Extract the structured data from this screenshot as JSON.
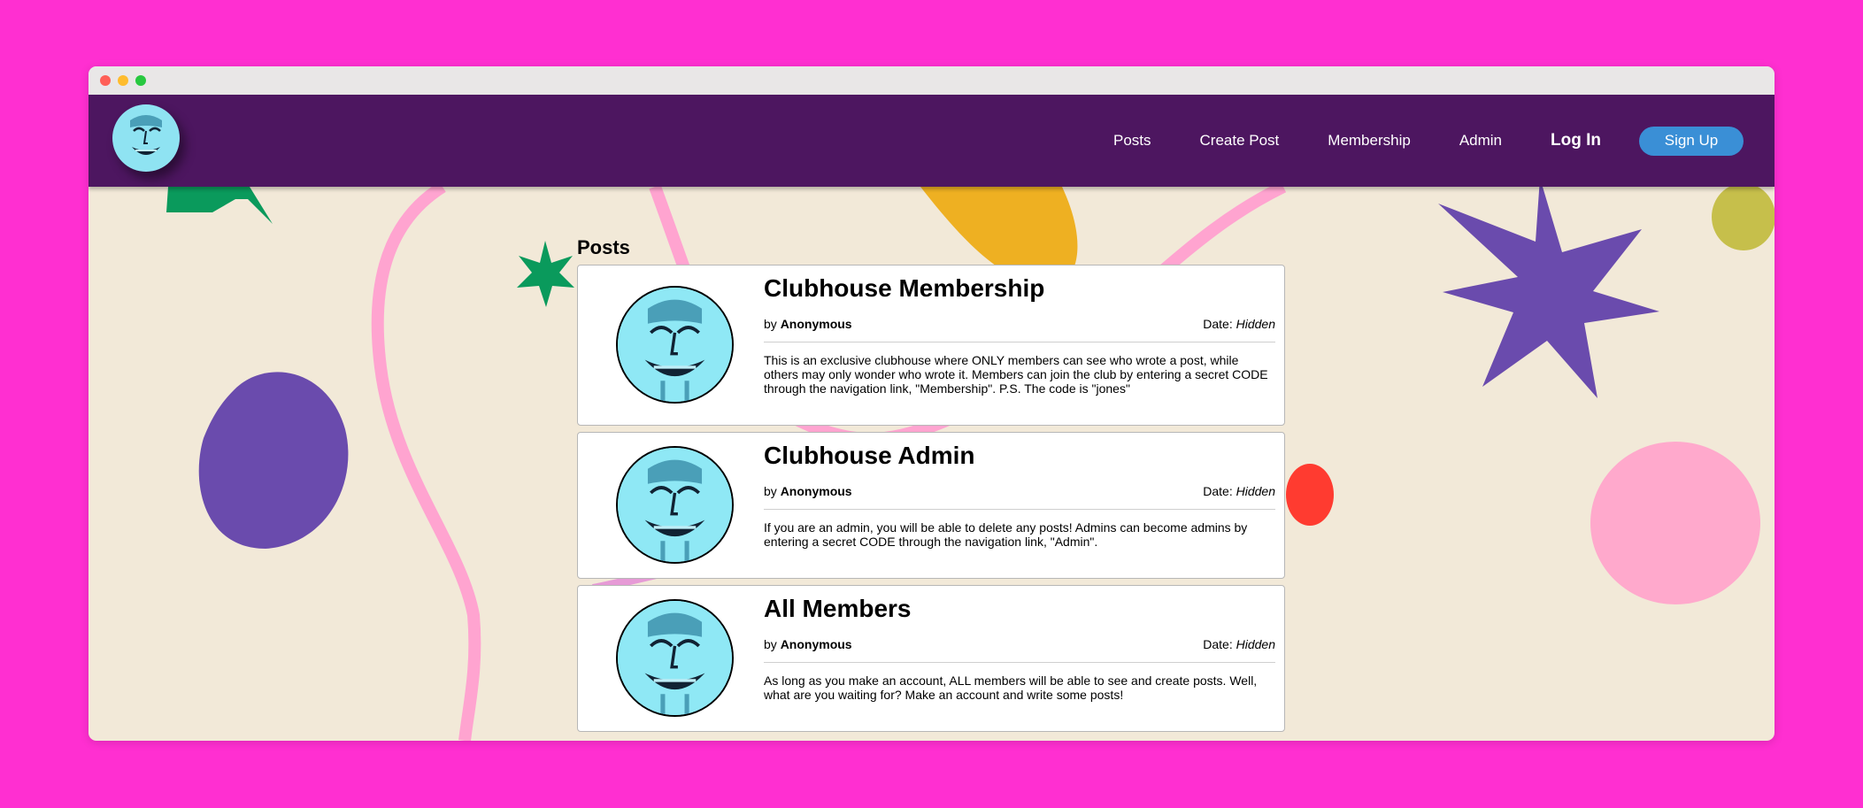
{
  "colors": {
    "background": "#ff2fd1",
    "navbar": "#4d1660",
    "page": "#f2e9d8",
    "signup": "#3a8fd6"
  },
  "logo_icon": "grinning-face-avatar-icon",
  "nav": {
    "links": [
      "Posts",
      "Create Post",
      "Membership",
      "Admin"
    ],
    "login": "Log In",
    "signup": "Sign Up"
  },
  "main": {
    "section_title": "Posts",
    "posts": [
      {
        "title": "Clubhouse Membership",
        "by_label": "by",
        "author": "Anonymous",
        "date_label": "Date:",
        "date": "Hidden",
        "text": "This is an exclusive clubhouse where ONLY members can see who wrote a post, while others may only wonder who wrote it. Members can join the club by entering a secret CODE through the navigation link, \"Membership\". P.S. The code is \"jones\""
      },
      {
        "title": "Clubhouse Admin",
        "by_label": "by",
        "author": "Anonymous",
        "date_label": "Date:",
        "date": "Hidden",
        "text": "If you are an admin, you will be able to delete any posts! Admins can become admins by entering a secret CODE through the navigation link, \"Admin\"."
      },
      {
        "title": "All Members",
        "by_label": "by",
        "author": "Anonymous",
        "date_label": "Date:",
        "date": "Hidden",
        "text": "As long as you make an account, ALL members will be able to see and create posts. Well, what are you waiting for? Make an account and write some posts!"
      }
    ]
  }
}
